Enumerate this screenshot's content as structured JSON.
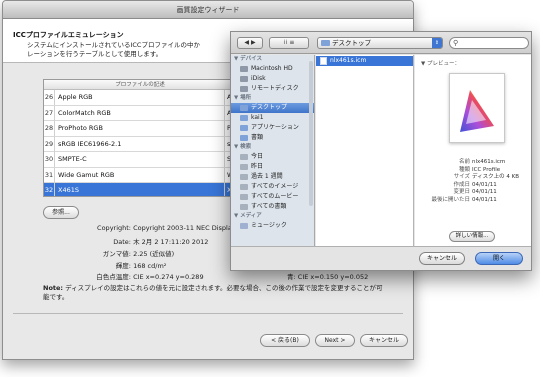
{
  "wizard": {
    "title": "画質設定ウィザード",
    "head_title": "ICCプロファイルエミュレーション",
    "head_desc_line1": "システムにインストールされているICCプロファイルの中か",
    "head_desc_line2": "レーションを行うテーブルとして使用します。",
    "table_header": "プロファイルの記述",
    "rows": [
      {
        "num": "26",
        "name": "Apple RGB",
        "col2": "App"
      },
      {
        "num": "27",
        "name": "ColorMatch RGB",
        "col2": "App"
      },
      {
        "num": "28",
        "name": "ProPhoto RGB",
        "col2": "Pro"
      },
      {
        "num": "29",
        "name": "sRGB IEC61966-2.1",
        "col2": "sRG"
      },
      {
        "num": "30",
        "name": "SMPTE-C",
        "col2": "SMI"
      },
      {
        "num": "31",
        "name": "Wide Gamut RGB",
        "col2": "Wid"
      },
      {
        "num": "32",
        "name": "X461S",
        "col2": "X46"
      }
    ],
    "browse_button": "参照...",
    "copyright_label": "Copyright:",
    "copyright_value": "Copyright 2003-11 NEC Display",
    "date_label": "Date:",
    "date_value": "木 2月 2 17:11:20 2012",
    "gamma_label": "ガンマ値:",
    "gamma_value": "2.25 (近似値)",
    "luminance_label": "輝度:",
    "luminance_value": "168 cd/m²",
    "whitepoint_label": "白色点温度:",
    "whitepoint_value": "CIE x=0.274 y=0.289",
    "blue_label": "青:",
    "blue_value": "CIE x=0.150 y=0.052",
    "note_bold": "Note:",
    "note_text": " ディスプレイの設定はこれらの値を元に設定されます。必要な場合、この後の作業で設定を変更することが可",
    "note_text2": "能です。",
    "back_button": "< 戻る(B)",
    "next_button": "Next >",
    "cancel_button": "キャンセル"
  },
  "dialog": {
    "nav_back": "◀",
    "nav_forward": "▶",
    "view_icon": "⁞⁞",
    "view_list": "≡",
    "location": "デスクトップ",
    "sidebar": {
      "devices_header": "▼ デバイス",
      "devices": [
        "Macintosh HD",
        "iDisk",
        "リモートディスク"
      ],
      "places_header": "▼ 場所",
      "places": [
        "デスクトップ",
        "kai1",
        "アプリケーション",
        "書類"
      ],
      "search_header": "▼ 検索",
      "search": [
        "今日",
        "昨日",
        "過去 1 週間",
        "すべてのイメージ",
        "すべてのムービー",
        "すべての書類"
      ],
      "media_header": "▼ メディア",
      "media": [
        "ミュージック"
      ]
    },
    "file": "nlx461s.icm",
    "preview_label": "▼ プレビュー：",
    "info": [
      {
        "k": "名前",
        "v": "nlx461s.icm"
      },
      {
        "k": "種類",
        "v": "ICC Profile"
      },
      {
        "k": "サイズ",
        "v": "ディスク上の 4 KB"
      },
      {
        "k": "作成日",
        "v": "04/01/11"
      },
      {
        "k": "変更日",
        "v": "04/01/11"
      },
      {
        "k": "最後に開いた日",
        "v": "04/01/11"
      }
    ],
    "more_info_button": "詳しい情報...",
    "cancel_button": "キャンセル",
    "open_button": "開く",
    "colors": {
      "selection": "#3875d7",
      "sidebar_bg": "#dde4ec"
    }
  }
}
